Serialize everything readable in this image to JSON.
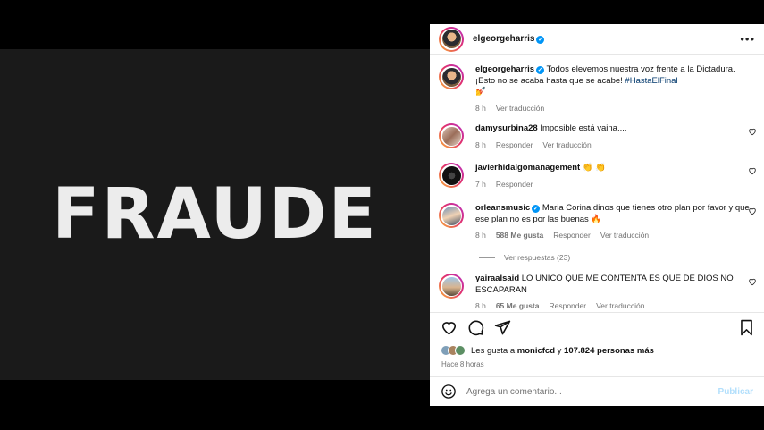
{
  "post_image": {
    "headline": "FRAUDE"
  },
  "header": {
    "username": "elgeorgeharris",
    "more_icon": "more-horizontal-icon"
  },
  "caption": {
    "username": "elgeorgeharris",
    "text": "Todos elevemos nuestra voz frente a la Dictadura. ¡Esto no se acaba hasta que se acabe!",
    "hashtag": "#HastaElFinal",
    "emoji": "💅",
    "time": "8 h",
    "translate": "Ver traducción"
  },
  "comments": [
    {
      "username": "damysurbina28",
      "text": "Imposible está vaina....",
      "time": "8 h",
      "reply": "Responder",
      "translate": "Ver traducción"
    },
    {
      "username": "javierhidalgomanagement",
      "text": "👏 👏",
      "time": "7 h",
      "reply": "Responder"
    },
    {
      "username": "orleansmusic",
      "text": "Maria Corina dinos que tienes otro plan por favor y que ese plan no es por las buenas 🔥",
      "time": "8 h",
      "likes": "588 Me gusta",
      "reply": "Responder",
      "translate": "Ver traducción"
    },
    {
      "username": "yairaalsaid",
      "text": "LO UNICO QUE ME CONTENTA ES QUE DE DIOS NO ESCAPARAN",
      "time": "8 h",
      "likes": "65 Me gusta",
      "reply": "Responder",
      "translate": "Ver traducción"
    }
  ],
  "view_replies": "Ver respuestas (23)",
  "likes": {
    "prefix": "Les gusta a",
    "user": "monicfcd",
    "joiner": "y",
    "count": "107.824 personas más"
  },
  "posted": "Hace 8 horas",
  "composer": {
    "placeholder": "Agrega un comentario...",
    "publish": "Publicar"
  },
  "colors": {
    "accent": "#0095f6",
    "verified": "#0095f6",
    "link": "#00376b",
    "publish_disabled": "#b2dffc"
  }
}
